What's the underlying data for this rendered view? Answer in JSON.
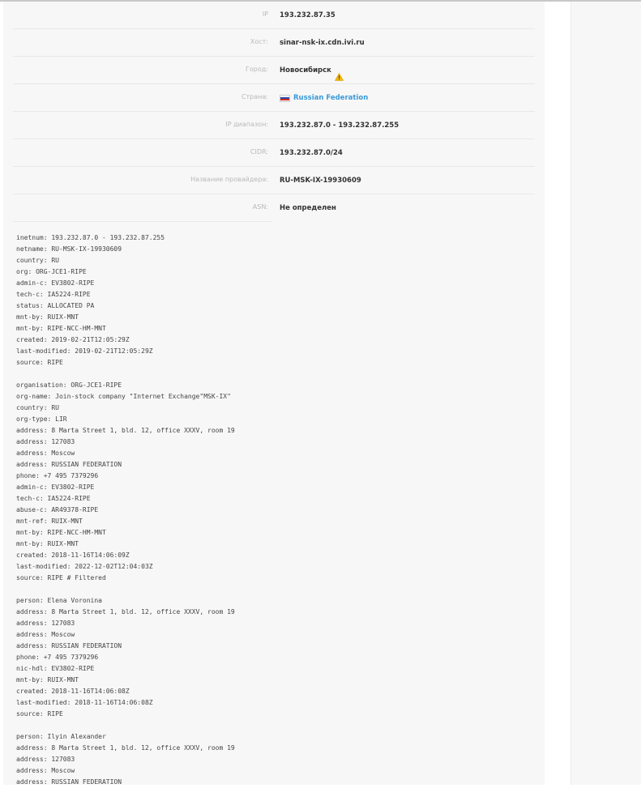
{
  "info_rows": [
    {
      "label": "IP",
      "value": "193.232.87.35"
    },
    {
      "label": "Хост:",
      "value": "sinar-nsk-ix.cdn.ivi.ru"
    },
    {
      "label": "Город:",
      "value": "Новосибирск"
    },
    {
      "label": "Страна:",
      "value": "Russian Federation"
    },
    {
      "label": "IP диапазон:",
      "value": "193.232.87.0 - 193.232.87.255"
    },
    {
      "label": "CIDR:",
      "value": "193.232.87.0/24"
    },
    {
      "label": "Название провайдера:",
      "value": "RU-MSK-IX-19930609"
    },
    {
      "label": "ASN:",
      "value": "Не определен"
    }
  ],
  "icons": {
    "city_warning": "warning-icon",
    "country_flag": "russia-flag-icon"
  },
  "colors": {
    "link": "#3a9ad9",
    "warning": "#f5b800"
  },
  "whois_lines": [
    "inetnum: 193.232.87.0 - 193.232.87.255",
    "netname: RU-MSK-IX-19930609",
    "country: RU",
    "org: ORG-JCE1-RIPE",
    "admin-c: EV3802-RIPE",
    "tech-c: IA5224-RIPE",
    "status: ALLOCATED PA",
    "mnt-by: RUIX-MNT",
    "mnt-by: RIPE-NCC-HM-MNT",
    "created: 2019-02-21T12:05:29Z",
    "last-modified: 2019-02-21T12:05:29Z",
    "source: RIPE",
    "",
    "organisation: ORG-JCE1-RIPE",
    "org-name: Join-stock company \"Internet Exchange\"MSK-IX\"",
    "country: RU",
    "org-type: LIR",
    "address: 8 Marta Street 1, bld. 12, office XXXV, room 19",
    "address: 127083",
    "address: Moscow",
    "address: RUSSIAN FEDERATION",
    "phone: +7 495 7379296",
    "admin-c: EV3802-RIPE",
    "tech-c: IA5224-RIPE",
    "abuse-c: AR49378-RIPE",
    "mnt-ref: RUIX-MNT",
    "mnt-by: RIPE-NCC-HM-MNT",
    "mnt-by: RUIX-MNT",
    "created: 2018-11-16T14:06:09Z",
    "last-modified: 2022-12-02T12:04:03Z",
    "source: RIPE # Filtered",
    "",
    "person: Elena Voronina",
    "address: 8 Marta Street 1, bld. 12, office XXXV, room 19",
    "address: 127083",
    "address: Moscow",
    "address: RUSSIAN FEDERATION",
    "phone: +7 495 7379296",
    "nic-hdl: EV3802-RIPE",
    "mnt-by: RUIX-MNT",
    "created: 2018-11-16T14:06:08Z",
    "last-modified: 2018-11-16T14:06:08Z",
    "source: RIPE",
    "",
    "person: Ilyin Alexander",
    "address: 8 Marta Street 1, bld. 12, office XXXV, room 19",
    "address: 127083",
    "address: Moscow",
    "address: RUSSIAN FEDERATION"
  ]
}
